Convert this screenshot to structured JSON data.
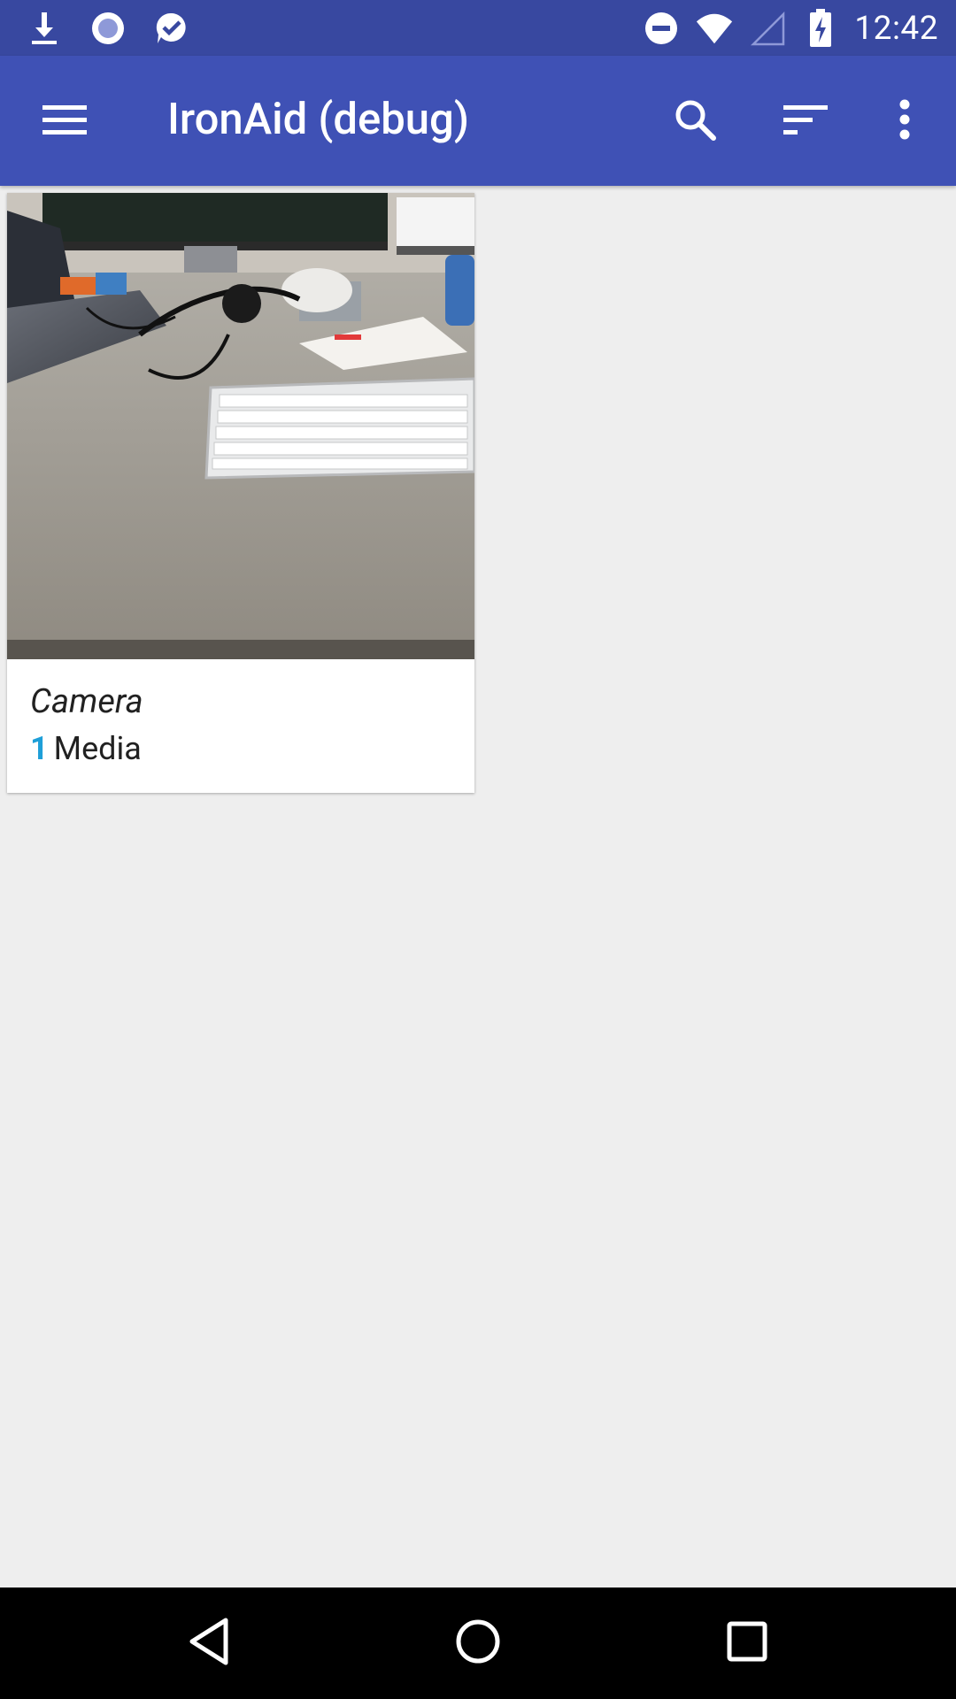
{
  "status_bar": {
    "time": "12:42",
    "left_icons": [
      "download-icon",
      "record-icon",
      "chat-check-icon"
    ],
    "right_icons": [
      "do-not-disturb-icon",
      "wifi-icon",
      "cell-signal-icon",
      "battery-charging-icon"
    ]
  },
  "app_bar": {
    "title": "IronAid (debug)",
    "menu_icon": "hamburger-menu-icon",
    "actions": [
      "search-icon",
      "sort-icon",
      "more-vert-icon"
    ]
  },
  "albums": [
    {
      "name": "Camera",
      "count": "1",
      "count_label": "Media",
      "thumbnail": "photo of desk with keyboard, monitor and laptop"
    }
  ],
  "nav_bar": {
    "buttons": [
      "back-icon",
      "home-icon",
      "recents-icon"
    ]
  },
  "colors": {
    "status_bar": "#3848a0",
    "app_bar": "#3f51b5",
    "background": "#eeeeee",
    "accent": "#1e9fd8",
    "nav_bar": "#000000"
  }
}
